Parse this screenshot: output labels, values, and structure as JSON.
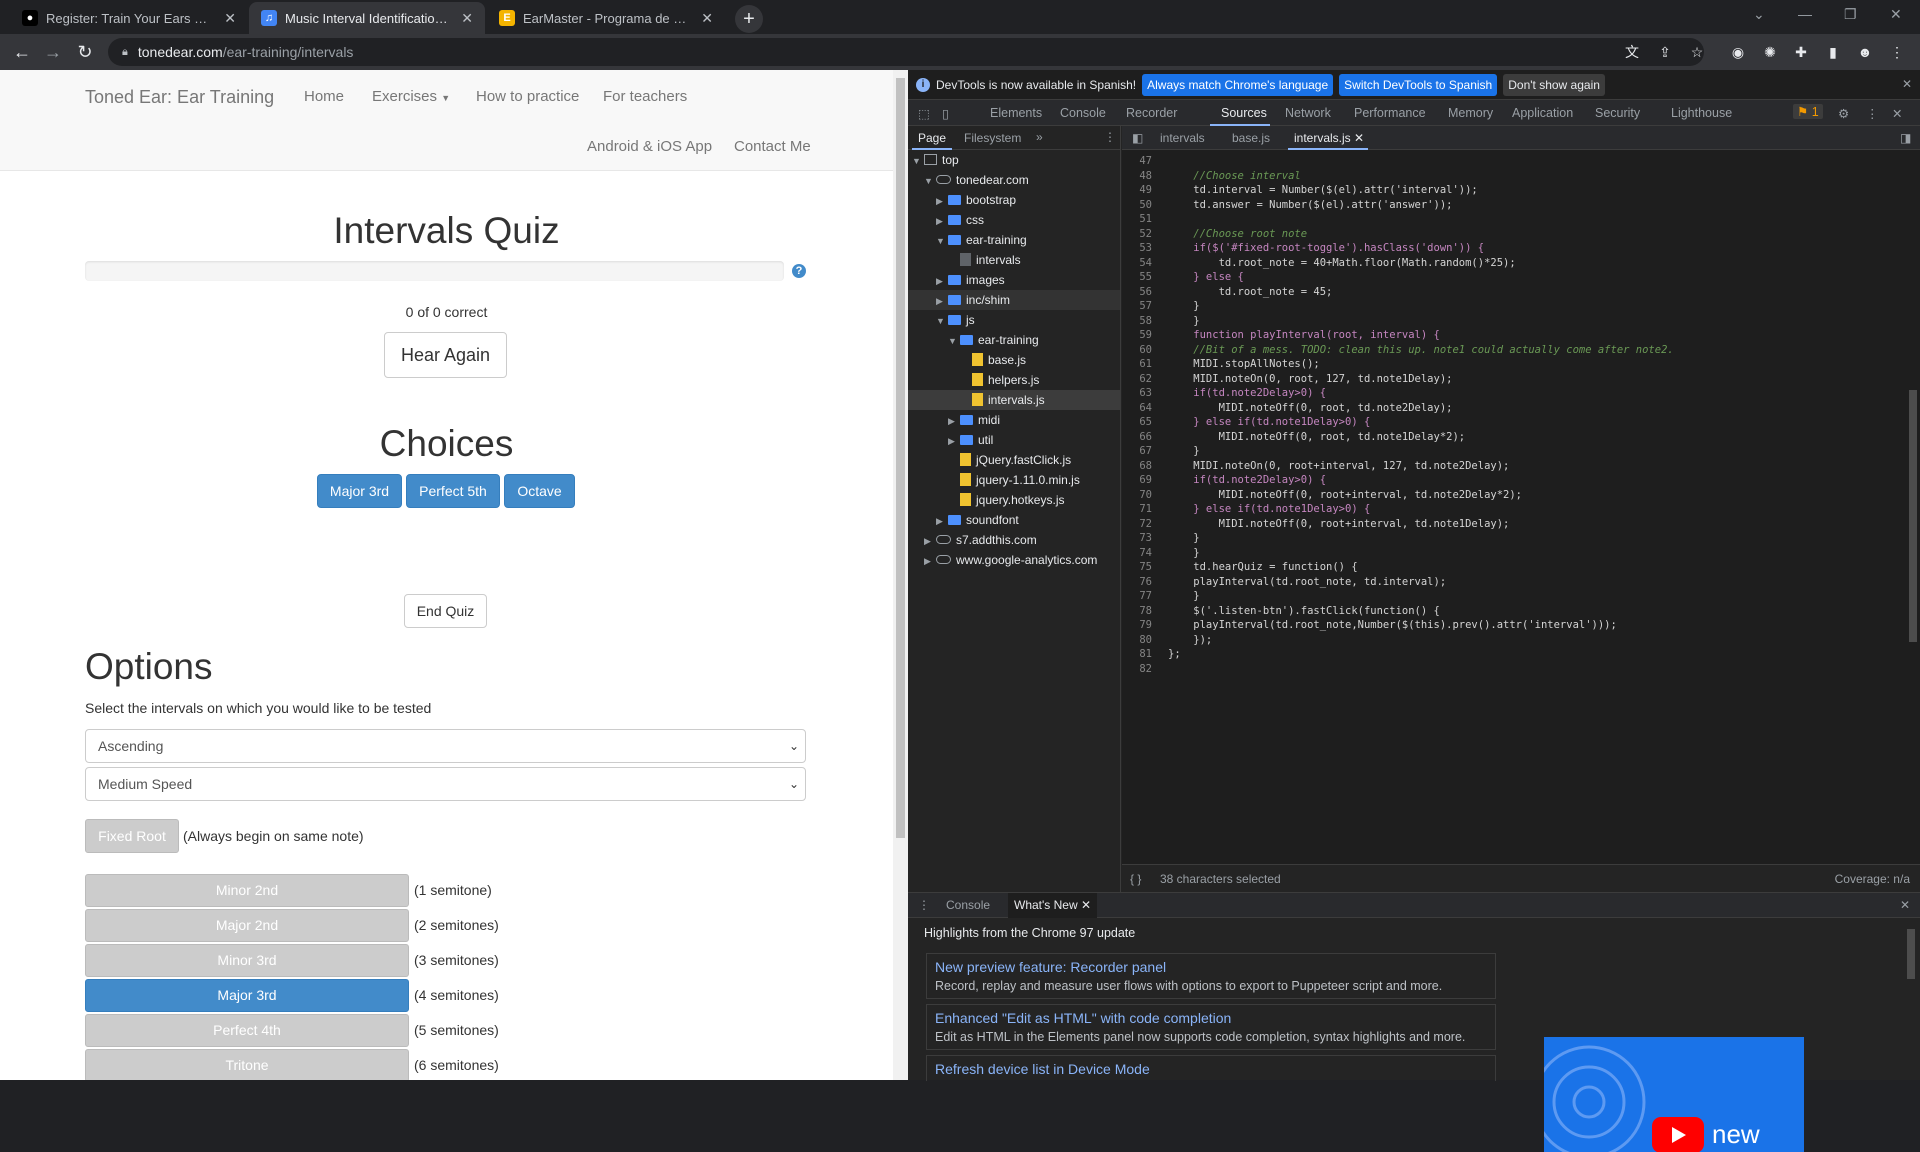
{
  "browser": {
    "tabs": [
      {
        "label": "Register: Train Your Ears with Tone"
      },
      {
        "label": "Music Interval Identification Ear T"
      },
      {
        "label": "EarMaster - Programa de Solfeo"
      }
    ],
    "url_host": "tonedear.com",
    "url_path": "/ear-training/intervals"
  },
  "site": {
    "brand": "Toned Ear: Ear Training",
    "nav": {
      "home": "Home",
      "exercises": "Exercises",
      "how_to_practice": "How to practice",
      "for_teachers": "For teachers",
      "app": "Android & iOS App",
      "contact": "Contact Me"
    },
    "quiz_title": "Intervals Quiz",
    "help_glyph": "?",
    "score": "0 of 0 correct",
    "hear_again": "Hear Again",
    "choices_title": "Choices",
    "choices": [
      "Major 3rd",
      "Perfect 5th",
      "Octave"
    ],
    "end_quiz": "End Quiz",
    "options_title": "Options",
    "options_instruction": "Select the intervals on which you would like to be tested",
    "direction_select": "Ascending",
    "speed_select": "Medium Speed",
    "fixed_root_label": "Fixed Root",
    "fixed_root_hint": "(Always begin on same note)",
    "intervals": [
      {
        "label": "Minor 2nd",
        "semitones": "(1 semitone)",
        "selected": false
      },
      {
        "label": "Major 2nd",
        "semitones": "(2 semitones)",
        "selected": false
      },
      {
        "label": "Minor 3rd",
        "semitones": "(3 semitones)",
        "selected": false
      },
      {
        "label": "Major 3rd",
        "semitones": "(4 semitones)",
        "selected": true
      },
      {
        "label": "Perfect 4th",
        "semitones": "(5 semitones)",
        "selected": false
      },
      {
        "label": "Tritone",
        "semitones": "(6 semitones)",
        "selected": false
      }
    ]
  },
  "devtools": {
    "infobar": {
      "message": "DevTools is now available in Spanish!",
      "btn_match": "Always match Chrome's language",
      "btn_switch": "Switch DevTools to Spanish",
      "btn_dismiss": "Don't show again"
    },
    "tabs": {
      "elements": "Elements",
      "console": "Console",
      "recorder": "Recorder",
      "sources": "Sources",
      "network": "Network",
      "performance": "Performance",
      "memory": "Memory",
      "application": "Application",
      "security": "Security",
      "lighthouse": "Lighthouse"
    },
    "issues_count": "1",
    "navigator": {
      "page_tab": "Page",
      "filesystem_tab": "Filesystem",
      "more": "»",
      "tree": {
        "top": "top",
        "domain": "tonedear.com",
        "bootstrap": "bootstrap",
        "css": "css",
        "ear_training": "ear-training",
        "intervals": "intervals",
        "images": "images",
        "inc_shim": "inc/shim",
        "js": "js",
        "js_ear_training": "ear-training",
        "base_js": "base.js",
        "helpers_js": "helpers.js",
        "intervals_js": "intervals.js",
        "midi": "midi",
        "util": "util",
        "fastclick": "jQuery.fastClick.js",
        "jquery": "jquery-1.11.0.min.js",
        "hotkeys": "jquery.hotkeys.js",
        "soundfont": "soundfont",
        "addthis": "s7.addthis.com",
        "analytics": "www.google-analytics.com"
      }
    },
    "editor": {
      "tabs": {
        "intervals": "intervals",
        "base": "base.js",
        "intervals_js": "intervals.js"
      },
      "status": "38 characters selected",
      "coverage": "Coverage: n/a",
      "code": [
        {
          "n": "47",
          "t": ""
        },
        {
          "n": "48",
          "t": "    //Choose interval"
        },
        {
          "n": "49",
          "t": "    td.interval = Number($(el).attr('interval'));"
        },
        {
          "n": "50",
          "t": "    td.answer = Number($(el).attr('answer'));"
        },
        {
          "n": "51",
          "t": ""
        },
        {
          "n": "52",
          "t": "    //Choose root note"
        },
        {
          "n": "53",
          "t": "    if($('#fixed-root-toggle').hasClass('down')) {"
        },
        {
          "n": "54",
          "t": "        td.root_note = 40+Math.floor(Math.random()*25);"
        },
        {
          "n": "55",
          "t": "    } else {"
        },
        {
          "n": "56",
          "t": "        td.root_note = 45;"
        },
        {
          "n": "57",
          "t": "    }"
        },
        {
          "n": "58",
          "t": "    }"
        },
        {
          "n": "59",
          "t": "    function playInterval(root, interval) {"
        },
        {
          "n": "60",
          "t": "    //Bit of a mess. TODO: clean this up. note1 could actually come after note2."
        },
        {
          "n": "61",
          "t": "    MIDI.stopAllNotes();"
        },
        {
          "n": "62",
          "t": "    MIDI.noteOn(0, root, 127, td.note1Delay);"
        },
        {
          "n": "63",
          "t": "    if(td.note2Delay>0) {"
        },
        {
          "n": "64",
          "t": "        MIDI.noteOff(0, root, td.note2Delay);"
        },
        {
          "n": "65",
          "t": "    } else if(td.note1Delay>0) {"
        },
        {
          "n": "66",
          "t": "        MIDI.noteOff(0, root, td.note1Delay*2);"
        },
        {
          "n": "67",
          "t": "    }"
        },
        {
          "n": "68",
          "t": "    MIDI.noteOn(0, root+interval, 127, td.note2Delay);"
        },
        {
          "n": "69",
          "t": "    if(td.note2Delay>0) {"
        },
        {
          "n": "70",
          "t": "        MIDI.noteOff(0, root+interval, td.note2Delay*2);"
        },
        {
          "n": "71",
          "t": "    } else if(td.note1Delay>0) {"
        },
        {
          "n": "72",
          "t": "        MIDI.noteOff(0, root+interval, td.note1Delay);"
        },
        {
          "n": "73",
          "t": "    }"
        },
        {
          "n": "74",
          "t": "    }"
        },
        {
          "n": "75",
          "t": "    td.hearQuiz = function() {"
        },
        {
          "n": "76",
          "t": "    playInterval(td.root_note, td.interval);"
        },
        {
          "n": "77",
          "t": "    }"
        },
        {
          "n": "78",
          "t": "    $('.listen-btn').fastClick(function() {"
        },
        {
          "n": "79",
          "t": "    playInterval(td.root_note,Number($(this).prev().attr('interval')));"
        },
        {
          "n": "80",
          "t": "    });"
        },
        {
          "n": "81",
          "t": "};"
        },
        {
          "n": "82",
          "t": ""
        }
      ]
    },
    "drawer": {
      "console_tab": "Console",
      "whatsnew_tab": "What's New",
      "highlights": "Highlights from the Chrome 97 update",
      "cards": [
        {
          "title": "New preview feature: Recorder panel",
          "desc": "Record, replay and measure user flows with options to export to Puppeteer script and more."
        },
        {
          "title": "Enhanced \"Edit as HTML\" with code completion",
          "desc": "Edit as HTML in the Elements panel now supports code completion, syntax highlights and more."
        },
        {
          "title": "Refresh device list in Device Mode",
          "desc": ""
        }
      ],
      "image_word": "new"
    }
  },
  "colors": {
    "bootstrap_primary": "#428bca",
    "devtools_accent": "#8ab4f8",
    "chrome_blue": "#1a73e8"
  }
}
